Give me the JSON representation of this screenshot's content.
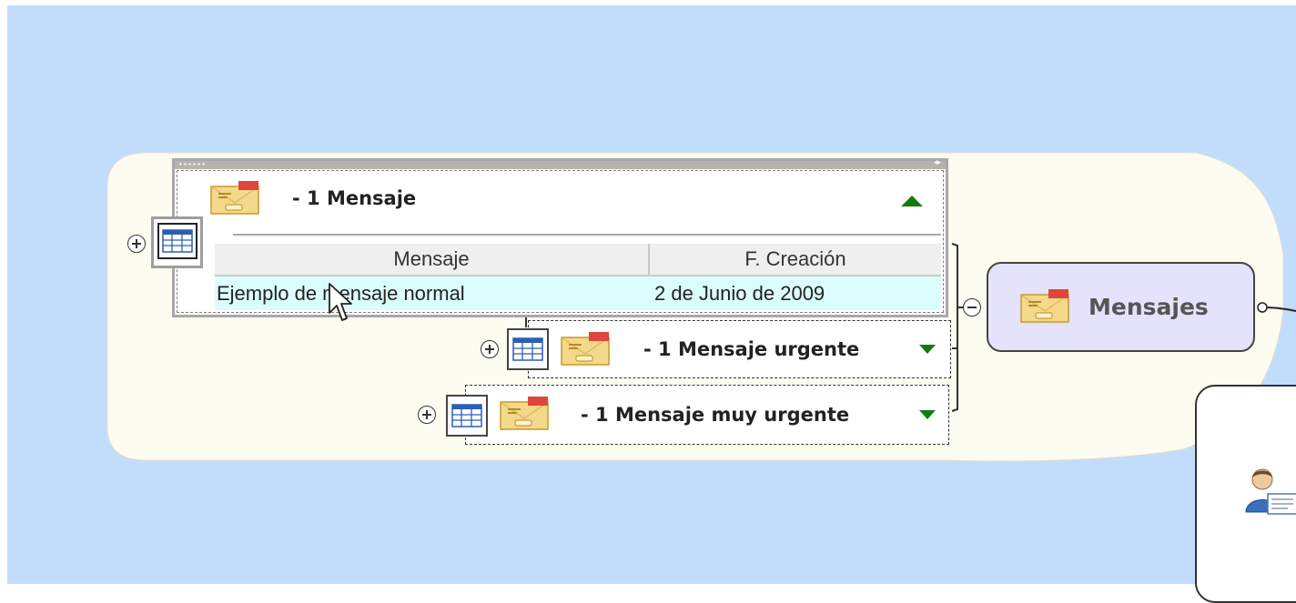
{
  "colors": {
    "canvas_background": "#c2dcfb",
    "group_background": "#fdfcf0",
    "topic_background": "#ffffff",
    "main_node_background": "#e4e3fb",
    "table_header_background": "#efefef",
    "table_row_background": "#dcfdfd",
    "expand_arrow": "#147a10"
  },
  "topics": {
    "mensaje": {
      "title": "- 1 Mensaje",
      "state": "expanded",
      "icon": "envelope-icon",
      "table": {
        "columns": [
          "Mensaje",
          "F. Creación"
        ],
        "rows": [
          [
            "Ejemplo de mensaje normal",
            "2 de Junio de 2009"
          ]
        ]
      }
    },
    "urgente": {
      "title": "- 1 Mensaje urgente",
      "state": "collapsed",
      "icon": "envelope-icon"
    },
    "muy_urgente": {
      "title": "- 1 Mensaje muy urgente",
      "state": "collapsed",
      "icon": "envelope-icon"
    }
  },
  "main_node": {
    "label": "Mensajes",
    "icon": "envelope-icon"
  },
  "user_node": {
    "icon": "user-card-icon"
  }
}
